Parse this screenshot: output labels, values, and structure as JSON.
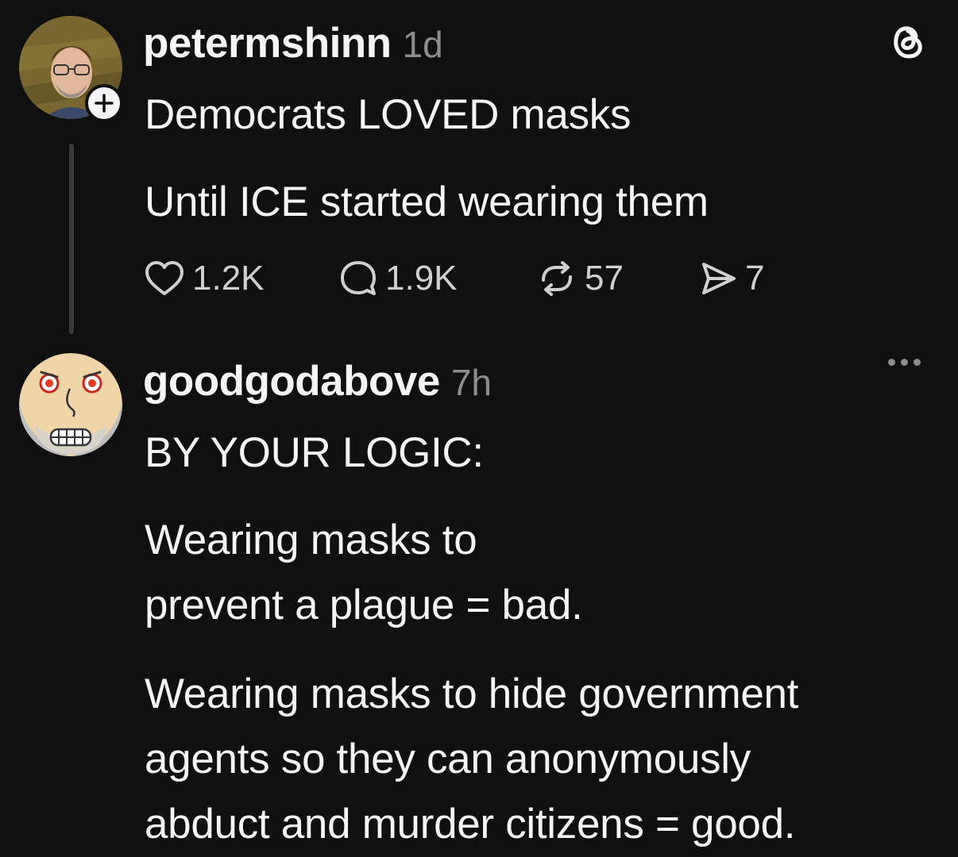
{
  "post": {
    "username": "petermshinn",
    "time": "1d",
    "avatar_icon": "avatar-photo-man-glasses",
    "paragraphs": [
      "Democrats LOVED masks",
      "Until ICE started wearing them"
    ],
    "likes": "1.2K",
    "replies": "1.9K",
    "reposts": "57",
    "shares": "7"
  },
  "reply": {
    "username": "goodgodabove",
    "time": "7h",
    "avatar_icon": "avatar-angry-cartoon-face",
    "paragraphs": [
      "BY YOUR LOGIC:",
      "Wearing masks to\nprevent a plague = bad.",
      "Wearing masks to hide government\nagents so they can anonymously\nabduct and murder citizens = good."
    ]
  },
  "icons": {
    "brand": "threads-logo-icon",
    "follow": "plus-icon",
    "like": "heart-icon",
    "reply": "comment-icon",
    "repost": "repost-icon",
    "share": "send-icon",
    "more": "more-options-icon"
  },
  "colors": {
    "background": "#101010",
    "text": "#f3f5f7",
    "secondary": "#8d8d8d"
  }
}
